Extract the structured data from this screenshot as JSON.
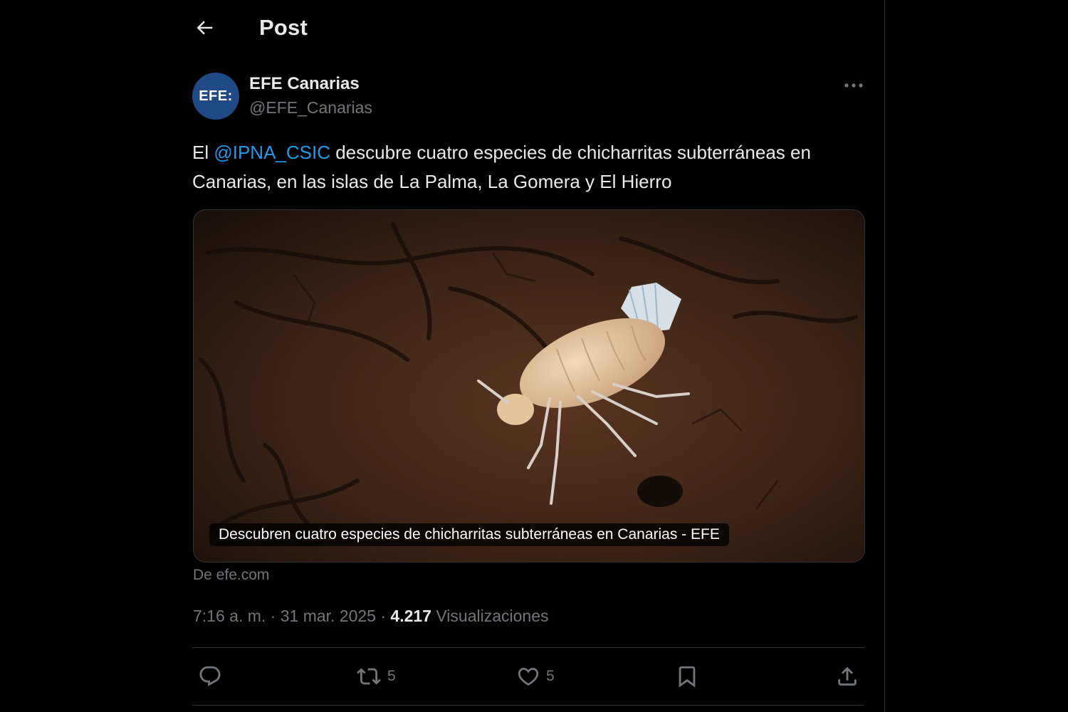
{
  "header": {
    "title": "Post"
  },
  "tweet": {
    "author_name": "EFE Canarias",
    "handle": "@EFE_Canarias",
    "avatar_text": "EFE:",
    "text_pre": "El ",
    "mention": "@IPNA_CSIC",
    "text_post": " descubre cuatro especies de chicharritas subterráneas en Canarias, en las islas de La Palma, La Gomera y El Hierro",
    "card": {
      "caption": "Descubren cuatro especies de chicharritas subterráneas en Canarias - EFE"
    },
    "source": "De efe.com",
    "time": "7:16 a. m. · 31 mar. 2025 · ",
    "views_count": "4.217",
    "views_label": " Visualizaciones"
  },
  "actions": {
    "reply_count": "",
    "repost_count": "5",
    "like_count": "5"
  },
  "icons": {
    "back": "arrow-left-icon",
    "more": "more-horizontal-icon",
    "reply": "reply-icon",
    "repost": "repost-icon",
    "like": "heart-icon",
    "bookmark": "bookmark-icon",
    "share": "share-icon"
  },
  "colors": {
    "background": "#000000",
    "text": "#e7e9ea",
    "secondary": "#71767b",
    "link": "#1d9bf0",
    "avatar_bg": "#1f4a86"
  }
}
